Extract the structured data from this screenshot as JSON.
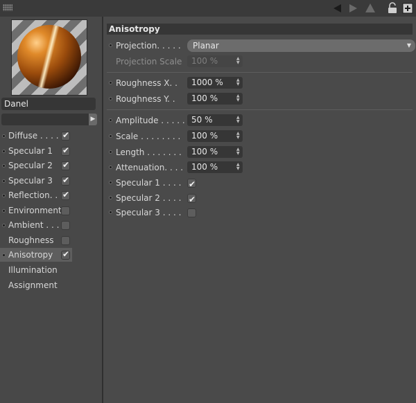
{
  "material": {
    "name": "Danel"
  },
  "channels": [
    {
      "label": "Diffuse . . . .",
      "checked": true,
      "has_dot": true,
      "active": false
    },
    {
      "label": "Specular 1",
      "checked": true,
      "has_dot": true,
      "active": false
    },
    {
      "label": "Specular 2",
      "checked": true,
      "has_dot": true,
      "active": false
    },
    {
      "label": "Specular 3",
      "checked": true,
      "has_dot": true,
      "active": false
    },
    {
      "label": "Reflection. .",
      "checked": true,
      "has_dot": true,
      "active": false
    },
    {
      "label": "Environment",
      "checked": false,
      "has_dot": true,
      "active": false
    },
    {
      "label": "Ambient . . .",
      "checked": false,
      "has_dot": true,
      "active": false
    },
    {
      "label": "Roughness",
      "checked": false,
      "has_dot": false,
      "active": false
    },
    {
      "label": "Anisotropy",
      "checked": true,
      "has_dot": true,
      "active": true
    }
  ],
  "extra_items": [
    "Illumination",
    "Assignment"
  ],
  "section": {
    "title": "Anisotropy"
  },
  "projection": {
    "label": "Projection. . . . .",
    "value": "Planar"
  },
  "projection_scale": {
    "label": "Projection Scale",
    "value": "100 %"
  },
  "roughness_x": {
    "label": "Roughness X. .",
    "value": "1000 %"
  },
  "roughness_y": {
    "label": "Roughness Y. .",
    "value": "100 %"
  },
  "amplitude": {
    "label": "Amplitude . . . . .",
    "value": "50 %"
  },
  "scale": {
    "label": "Scale . . . . . . . .",
    "value": "100 %"
  },
  "length": {
    "label": "Length . . . . . . .",
    "value": "100 %"
  },
  "attenuation": {
    "label": "Attenuation. . . .",
    "value": "100 %"
  },
  "spec_toggles": [
    {
      "label": "Specular 1 . . . .",
      "checked": true
    },
    {
      "label": "Specular 2 . . . .",
      "checked": true
    },
    {
      "label": "Specular 3 . . . .",
      "checked": false
    }
  ],
  "colors": {
    "panel": "#4a4a4a",
    "field": "#363636",
    "active_row": "#5e5e5e"
  }
}
